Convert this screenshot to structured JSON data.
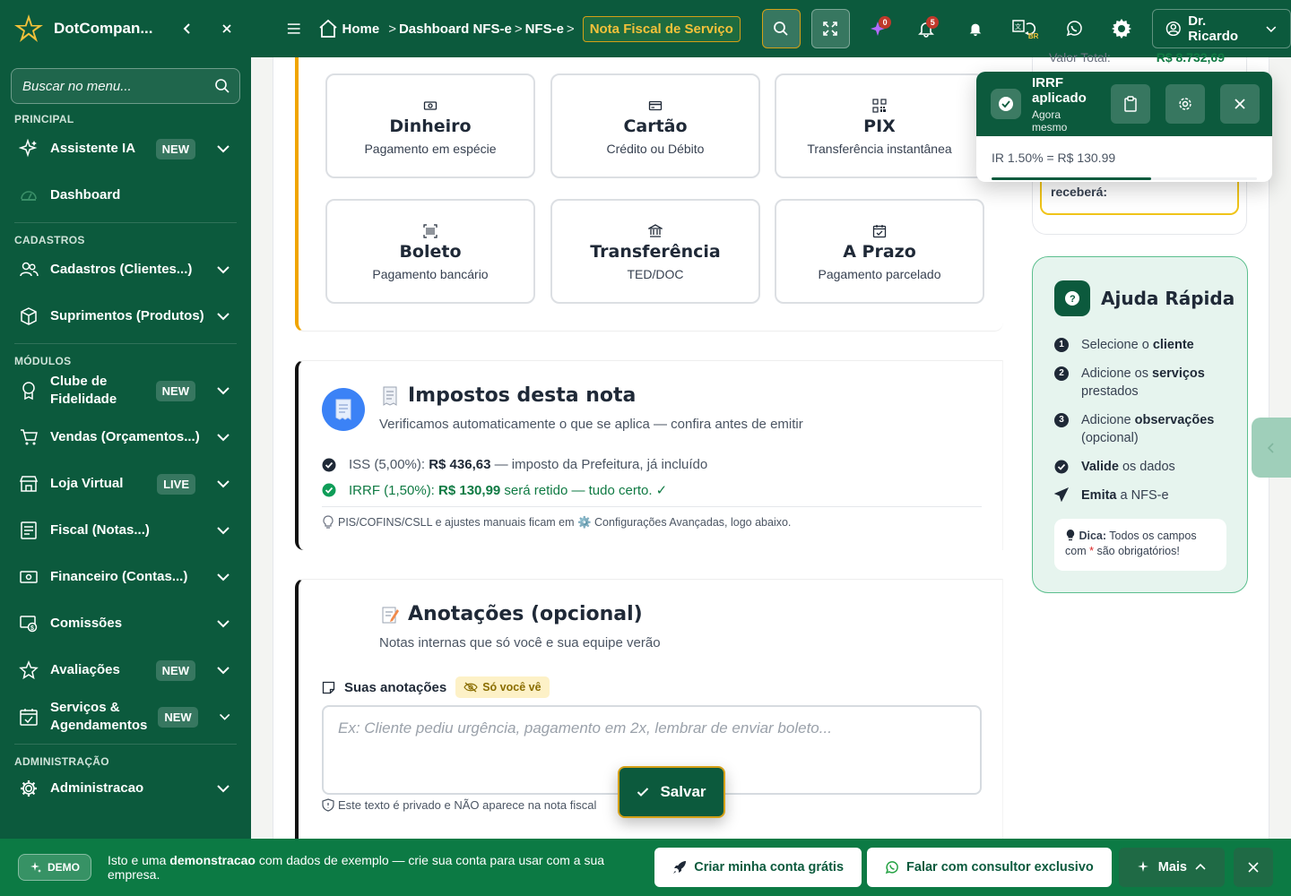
{
  "sidebar": {
    "brand": "DotCompan...",
    "search_placeholder": "Buscar no menu...",
    "sections": {
      "principal": "PRINCIPAL",
      "cadastros": "CADASTROS",
      "modulos": "MÓDULOS",
      "admin": "ADMINISTRAÇÃO"
    },
    "items": [
      {
        "label": "Assistente IA",
        "badge": "NEW"
      },
      {
        "label": "Dashboard"
      },
      {
        "label": "Cadastros (Clientes...)"
      },
      {
        "label": "Suprimentos (Produtos)"
      },
      {
        "label": "Clube de Fidelidade",
        "badge": "NEW"
      },
      {
        "label": "Vendas (Orçamentos...)"
      },
      {
        "label": "Loja Virtual",
        "badge": "LIVE"
      },
      {
        "label": "Fiscal (Notas...)"
      },
      {
        "label": "Financeiro (Contas...)"
      },
      {
        "label": "Comissões"
      },
      {
        "label": "Avaliações",
        "badge": "NEW"
      },
      {
        "label": "Serviços & Agendamentos",
        "badge": "NEW"
      },
      {
        "label": "Administracao"
      }
    ]
  },
  "topbar": {
    "breadcrumb": {
      "home": "Home",
      "c1": "Dashboard NFS-e",
      "c2": "NFS-e",
      "active": "Nota Fiscal de Serviço"
    },
    "ai_count": "0",
    "notif_count": "5",
    "lang": "BR",
    "user": "Dr. Ricardo"
  },
  "payment": {
    "options": [
      {
        "title": "Dinheiro",
        "subtitle": "Pagamento em espécie",
        "icon": "cash-icon"
      },
      {
        "title": "Cartão",
        "subtitle": "Crédito ou Débito",
        "icon": "card-icon"
      },
      {
        "title": "PIX",
        "subtitle": "Transferência instantânea",
        "icon": "qr-icon"
      },
      {
        "title": "Boleto",
        "subtitle": "Pagamento bancário",
        "icon": "barcode-icon"
      },
      {
        "title": "Transferência",
        "subtitle": "TED/DOC",
        "icon": "bank-icon"
      },
      {
        "title": "A Prazo",
        "subtitle": "Pagamento parcelado",
        "icon": "calendar-icon"
      }
    ]
  },
  "taxes": {
    "title": "Impostos desta nota",
    "subtitle": "Verificamos automaticamente o que se aplica — confira antes de emitir",
    "iss": {
      "label": "ISS (5,00%): ",
      "value": "R$ 436,63",
      "note": " — imposto da Prefeitura, já incluído"
    },
    "irrf": {
      "label": "IRRF (1,50%): ",
      "value": "R$ 130,99",
      "note": " será retido — tudo certo. ✓"
    },
    "footnote": "PIS/COFINS/CSLL e ajustes manuais ficam em ⚙️ Configurações Avançadas, logo abaixo."
  },
  "notes": {
    "title": "Anotações (opcional)",
    "subtitle": "Notas internas que só você e sua equipe verão",
    "label": "Suas anotações",
    "badge": "Só você vê",
    "placeholder": "Ex: Cliente pediu urgência, pagamento em 2x, lembrar de enviar boleto...",
    "hint": "Este texto é privado e NÃO aparece na nota fiscal",
    "save": "Salvar"
  },
  "summary": {
    "total_label": "Valor Total:",
    "total_value": "R$ 8.732,69",
    "receive_text": "receberá:"
  },
  "help": {
    "title": "Ajuda Rápida",
    "steps": [
      {
        "num": "1",
        "pre": "Selecione o ",
        "bold": "cliente",
        "post": ""
      },
      {
        "num": "2",
        "pre": "Adicione os ",
        "bold": "serviços",
        "post": " prestados"
      },
      {
        "num": "3",
        "pre": "Adicione ",
        "bold": "observações",
        "post": " (opcional)"
      },
      {
        "pre": "",
        "bold": "Valide",
        "post": " os dados"
      },
      {
        "pre": "",
        "bold": "Emita",
        "post": " a NFS-e"
      }
    ],
    "tip_bold": "Dica:",
    "tip_text": " Todos os campos com ",
    "tip_star": "*",
    "tip_end": " são obrigatórios!"
  },
  "toast": {
    "title": "IRRF aplicado",
    "time": "Agora mesmo",
    "body": "IR 1.50% = R$ 130.99",
    "progress": 0.6
  },
  "bottombar": {
    "demo": "DEMO",
    "msg_pre": "Isto e uma ",
    "msg_bold": "demonstracao",
    "msg_post": " com dados de exemplo — crie sua conta para usar com a sua empresa.",
    "create": "Criar minha conta grátis",
    "whatsapp": "Falar com consultor exclusivo",
    "more": "Mais"
  },
  "colors": {
    "brand": "#0c5a3d",
    "accent": "#d4a017",
    "success": "#0f7a43"
  }
}
